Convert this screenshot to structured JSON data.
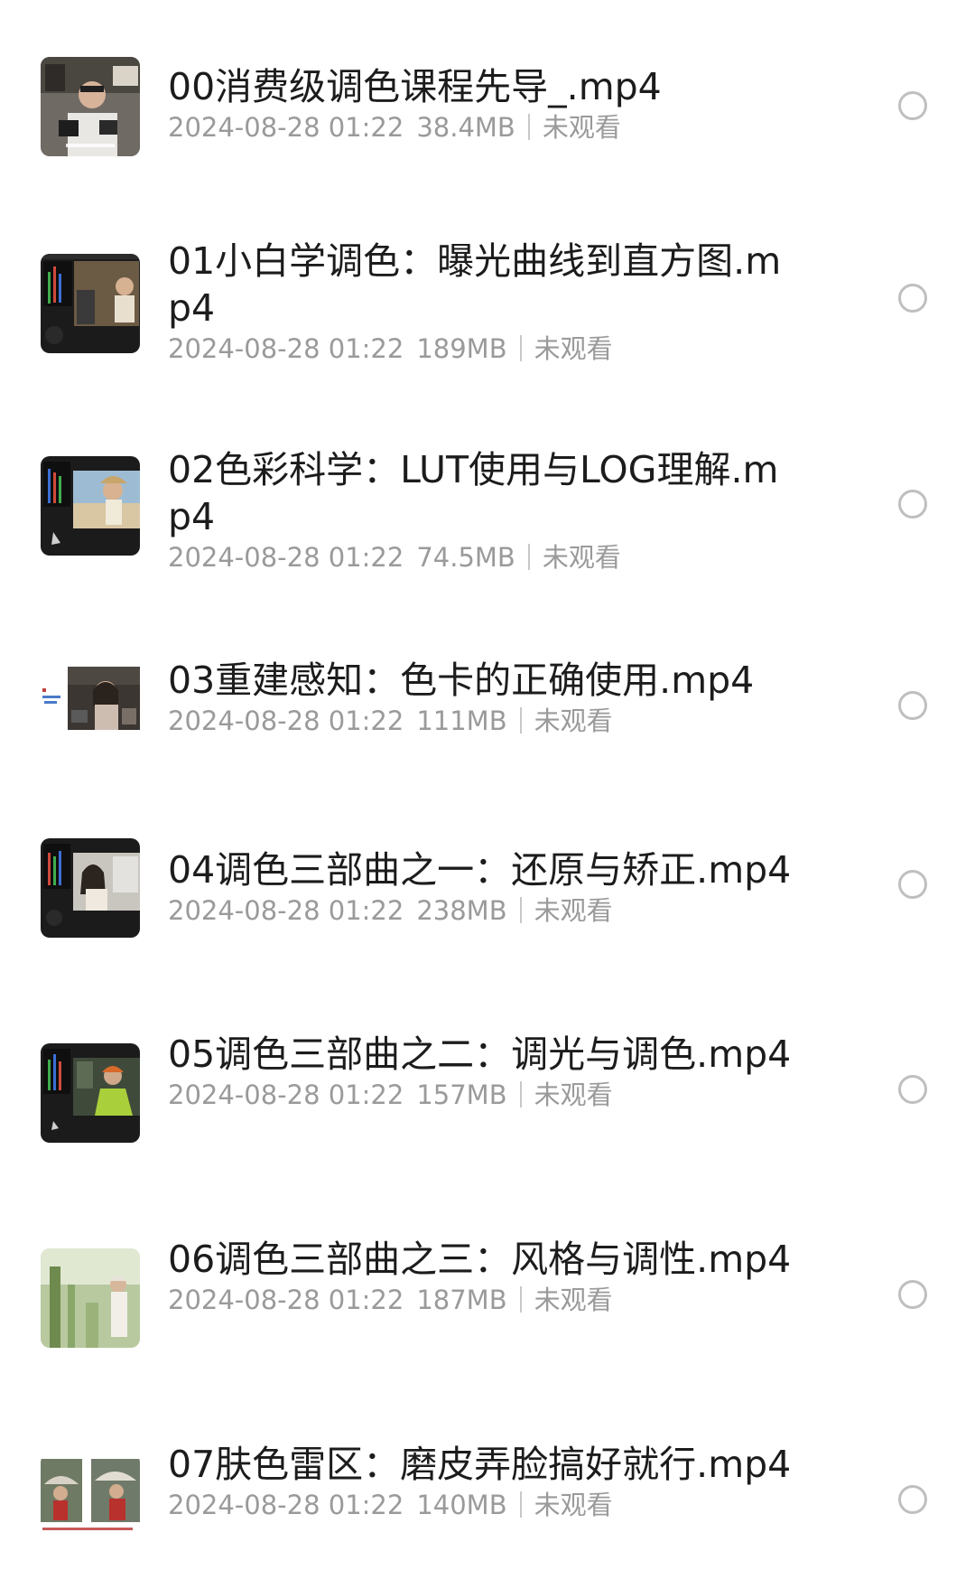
{
  "file_list": {
    "items": [
      {
        "name": "00消费级调色课程先导_.mp4",
        "date": "2024-08-28 01:22",
        "size": "38.4MB",
        "status": "未观看",
        "thumbnail": "video-thumbnail-man-with-camera"
      },
      {
        "name": "01小白学调色：曝光曲线到直方图.mp4",
        "date": "2024-08-28 01:22",
        "size": "189MB",
        "status": "未观看",
        "thumbnail": "video-thumbnail-editing-screen-man"
      },
      {
        "name": "02色彩科学：LUT使用与LOG理解.mp4",
        "date": "2024-08-28 01:22",
        "size": "74.5MB",
        "status": "未观看",
        "thumbnail": "video-thumbnail-editing-screen-beach"
      },
      {
        "name": "03重建感知：色卡的正确使用.mp4",
        "date": "2024-08-28 01:22",
        "size": "111MB",
        "status": "未观看",
        "thumbnail": "video-thumbnail-girl-color-card"
      },
      {
        "name": "04调色三部曲之一：还原与矫正.mp4",
        "date": "2024-08-28 01:22",
        "size": "238MB",
        "status": "未观看",
        "thumbnail": "video-thumbnail-editing-screen-woman"
      },
      {
        "name": "05调色三部曲之二：调光与调色.mp4",
        "date": "2024-08-28 01:22",
        "size": "157MB",
        "status": "未观看",
        "thumbnail": "video-thumbnail-editing-screen-worker"
      },
      {
        "name": "06调色三部曲之三：风格与调性.mp4",
        "date": "2024-08-28 01:22",
        "size": "187MB",
        "status": "未观看",
        "thumbnail": "video-thumbnail-forest-girl"
      },
      {
        "name": "07肤色雷区：磨皮弄脸搞好就行.mp4",
        "date": "2024-08-28 01:22",
        "size": "140MB",
        "status": "未观看",
        "thumbnail": "video-thumbnail-umbrella-woman"
      }
    ]
  },
  "colors": {
    "title_text": "#1c1c1c",
    "meta_text": "#9a9a9a",
    "radio_border": "#bfbfbf",
    "background": "#ffffff"
  }
}
